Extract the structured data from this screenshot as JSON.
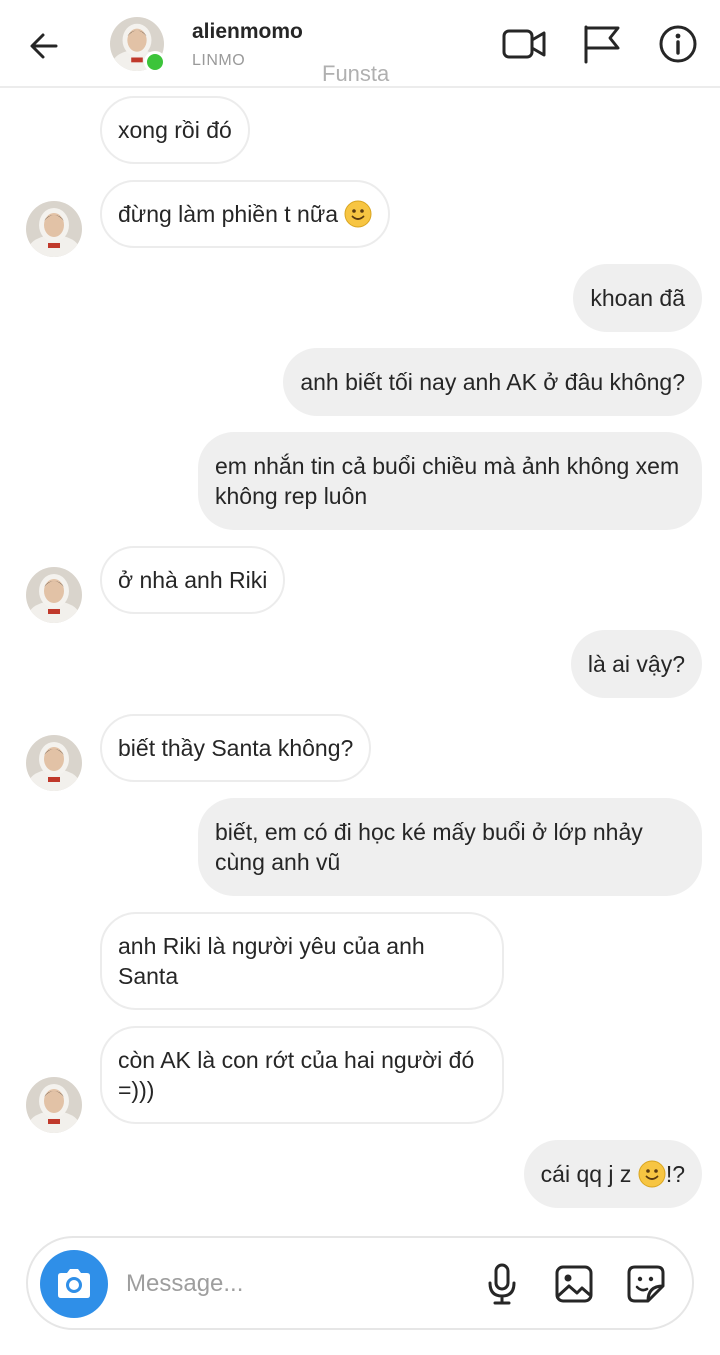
{
  "header": {
    "username": "alienmomo",
    "subtitle": "LINMO",
    "tag": "Funsta"
  },
  "messages": [
    {
      "side": "in",
      "text": "xong rồi đó"
    },
    {
      "side": "in",
      "text": "đừng làm phiền t nữa",
      "emoji": "slightly-smiling-face"
    },
    {
      "side": "out",
      "text": "khoan đã"
    },
    {
      "side": "out",
      "text": "anh biết tối nay anh AK ở đâu không?"
    },
    {
      "side": "out",
      "text": "em nhắn tin cả buổi chiều mà ảnh không xem không rep luôn"
    },
    {
      "side": "in",
      "text": "ở nhà anh Riki"
    },
    {
      "side": "out",
      "text": "là ai vậy?"
    },
    {
      "side": "in",
      "text": "biết thầy Santa không?"
    },
    {
      "side": "out",
      "text": "biết, em có đi học ké mấy buổi ở lớp nhảy cùng anh vũ"
    },
    {
      "side": "in",
      "text": "anh Riki là người yêu của anh Santa"
    },
    {
      "side": "in",
      "text": "còn AK là con rớt của hai người đó =)))"
    },
    {
      "side": "out",
      "text_before": "cái qq j z ",
      "emoji": "slightly-smiling-face",
      "text_after": "!?"
    }
  ],
  "composer": {
    "placeholder": "Message..."
  },
  "icons": {
    "back": "arrow-left-icon",
    "video": "video-call-icon",
    "flag": "flag-icon",
    "info": "info-icon",
    "camera": "camera-icon",
    "mic": "microphone-icon",
    "gallery": "image-icon",
    "sticker": "sticker-icon"
  },
  "colors": {
    "accent": "#2f8fe8",
    "online": "#3cc43a",
    "outgoing_bubble": "#efefef",
    "incoming_border": "#ececec"
  }
}
